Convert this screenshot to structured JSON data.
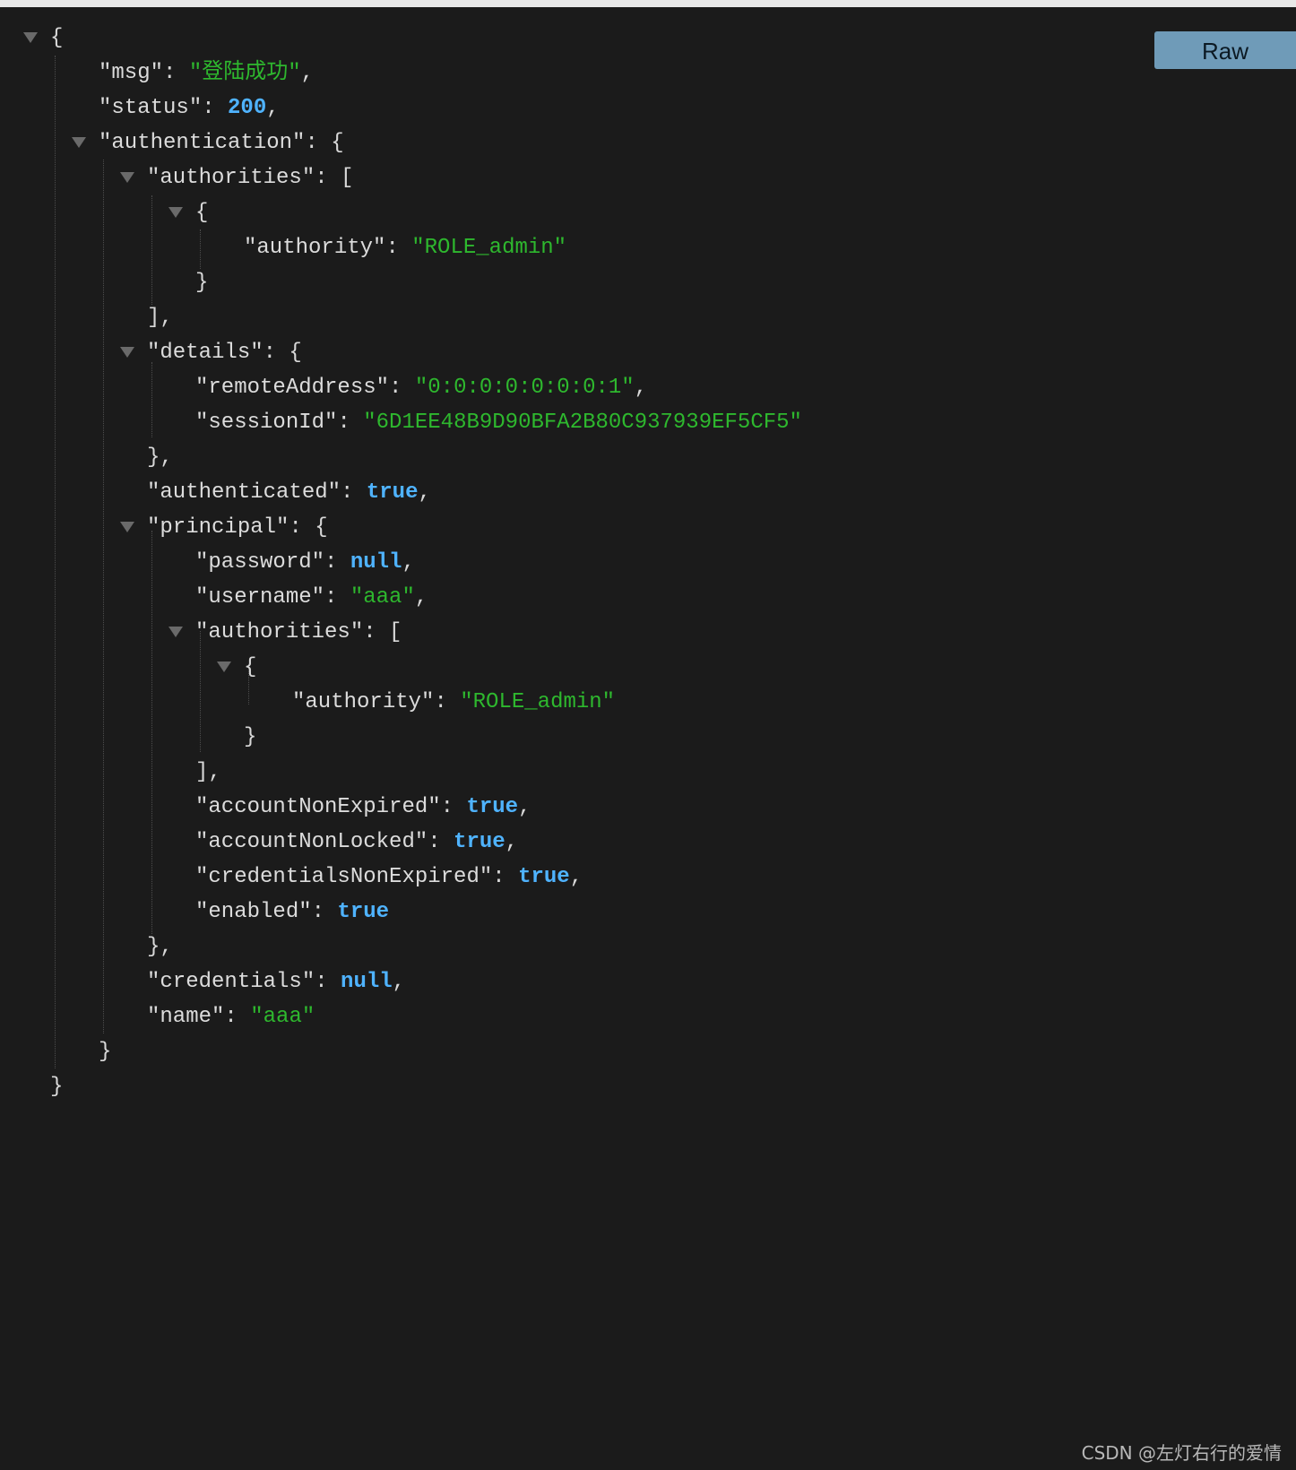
{
  "toolbar": {
    "raw_label": "Raw"
  },
  "json": {
    "msg_key": "\"msg\"",
    "msg_value": "\"登陆成功\"",
    "status_key": "\"status\"",
    "status_value": "200",
    "authentication_key": "\"authentication\"",
    "authorities_key": "\"authorities\"",
    "authority_key": "\"authority\"",
    "authority_value": "\"ROLE_admin\"",
    "details_key": "\"details\"",
    "remote_address_key": "\"remoteAddress\"",
    "remote_address_value": "\"0:0:0:0:0:0:0:1\"",
    "session_id_key": "\"sessionId\"",
    "session_id_value": "\"6D1EE48B9D90BFA2B80C937939EF5CF5\"",
    "authenticated_key": "\"authenticated\"",
    "authenticated_value": "true",
    "principal_key": "\"principal\"",
    "password_key": "\"password\"",
    "password_value": "null",
    "username_key": "\"username\"",
    "username_value": "\"aaa\"",
    "principal_authorities_key": "\"authorities\"",
    "principal_authority_key": "\"authority\"",
    "principal_authority_value": "\"ROLE_admin\"",
    "account_non_expired_key": "\"accountNonExpired\"",
    "account_non_expired_value": "true",
    "account_non_locked_key": "\"accountNonLocked\"",
    "account_non_locked_value": "true",
    "credentials_non_expired_key": "\"credentialsNonExpired\"",
    "credentials_non_expired_value": "true",
    "enabled_key": "\"enabled\"",
    "enabled_value": "true",
    "credentials_key": "\"credentials\"",
    "credentials_value": "null",
    "name_key": "\"name\"",
    "name_value": "\"aaa\""
  },
  "watermark": "CSDN @左灯右行的爱情"
}
